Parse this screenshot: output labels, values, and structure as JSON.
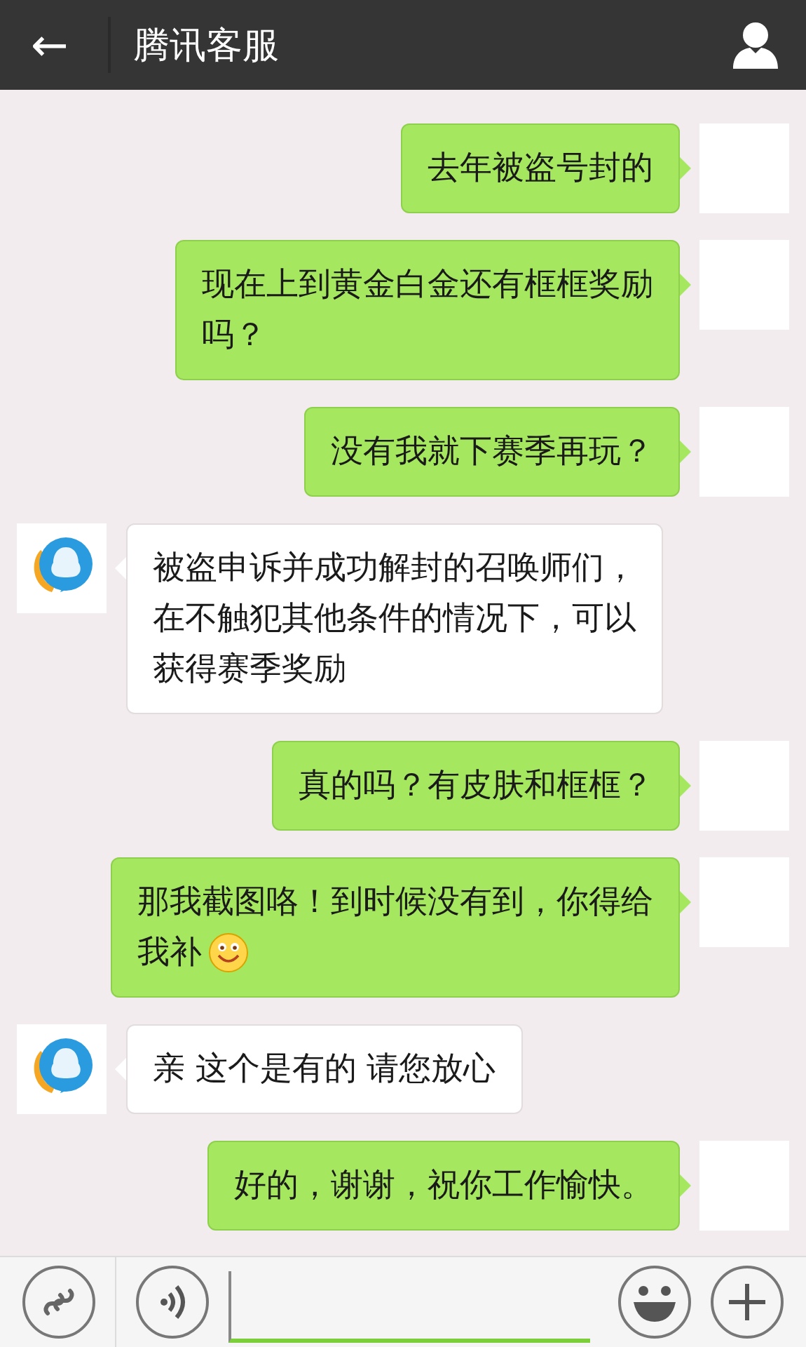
{
  "header": {
    "back": "←",
    "title": "腾讯客服"
  },
  "messages": [
    {
      "kind": "me",
      "lines": [
        "去年被盗号封的"
      ],
      "trailing_emoji": false
    },
    {
      "kind": "me",
      "lines": [
        "现在上到黄金白金还有框框奖励",
        "吗？"
      ],
      "trailing_emoji": false
    },
    {
      "kind": "me",
      "lines": [
        "没有我就下赛季再玩？"
      ],
      "trailing_emoji": false
    },
    {
      "kind": "agent",
      "lines": [
        "被盗申诉并成功解封的召唤师们，",
        "在不触犯其他条件的情况下，可以",
        "获得赛季奖励"
      ],
      "trailing_emoji": false
    },
    {
      "kind": "me",
      "lines": [
        "真的吗？有皮肤和框框？"
      ],
      "trailing_emoji": false
    },
    {
      "kind": "me",
      "lines": [
        "那我截图咯！到时候没有到，你得给",
        "我补"
      ],
      "trailing_emoji": true
    },
    {
      "kind": "agent",
      "lines": [
        "亲 这个是有的 请您放心"
      ],
      "trailing_emoji": false
    },
    {
      "kind": "me",
      "lines": [
        "好的，谢谢，祝你工作愉快。"
      ],
      "trailing_emoji": false
    }
  ]
}
